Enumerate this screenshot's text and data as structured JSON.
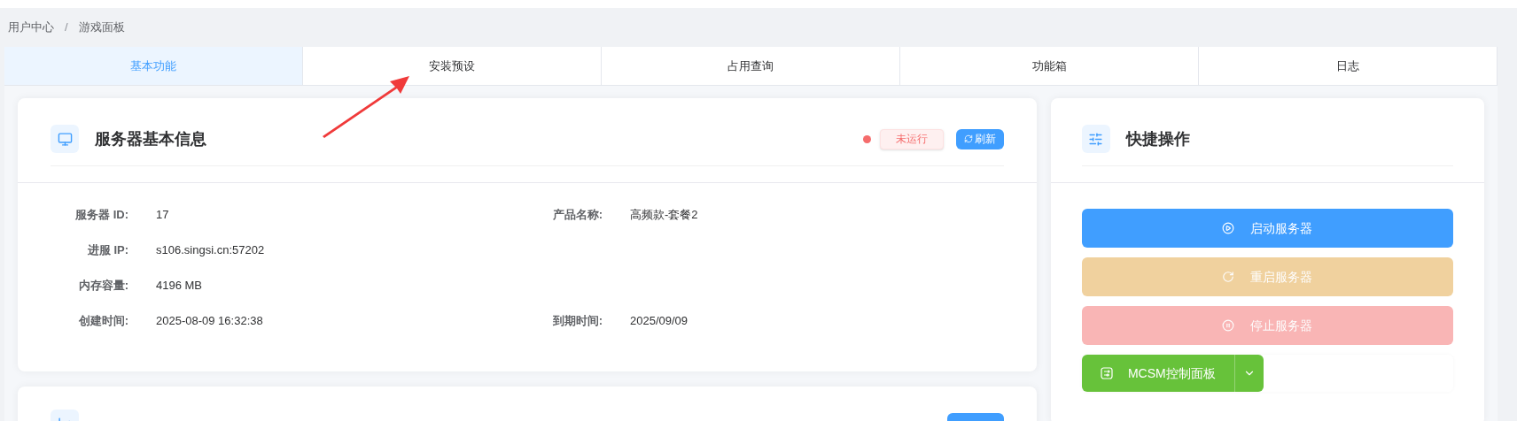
{
  "breadcrumb": [
    "用户中心",
    "游戏面板"
  ],
  "breadcrumb_separator": "/",
  "tabs": [
    {
      "label": "基本功能",
      "selected": true
    },
    {
      "label": "安装预设",
      "selected": false
    },
    {
      "label": "占用查询",
      "selected": false
    },
    {
      "label": "功能箱",
      "selected": false
    },
    {
      "label": "日志",
      "selected": false
    }
  ],
  "server_info": {
    "title": "服务器基本信息",
    "status": {
      "label": "未运行",
      "running": false
    },
    "refresh_button": "刷新",
    "rows": [
      [
        {
          "label": "服务器 ID:",
          "value": "17"
        },
        {
          "label": "产品名称:",
          "value": "高频款-套餐2"
        }
      ],
      [
        {
          "label": "进服 IP:",
          "value": "s106.singsi.cn:57202"
        }
      ],
      [
        {
          "label": "内存容量:",
          "value": "4196 MB"
        }
      ],
      [
        {
          "label": "创建时间:",
          "value": "2025-08-09 16:32:38"
        },
        {
          "label": "到期时间:",
          "value": "2025/09/09"
        }
      ]
    ]
  },
  "quick_actions": {
    "title": "快捷操作",
    "buttons": [
      {
        "kind": "start",
        "label": "启动服务器",
        "disabled": false
      },
      {
        "kind": "restart",
        "label": "重启服务器",
        "disabled": true
      },
      {
        "kind": "stop",
        "label": "停止服务器",
        "disabled": true
      }
    ],
    "panel_button": {
      "label": "MCSM控制面板"
    }
  }
}
